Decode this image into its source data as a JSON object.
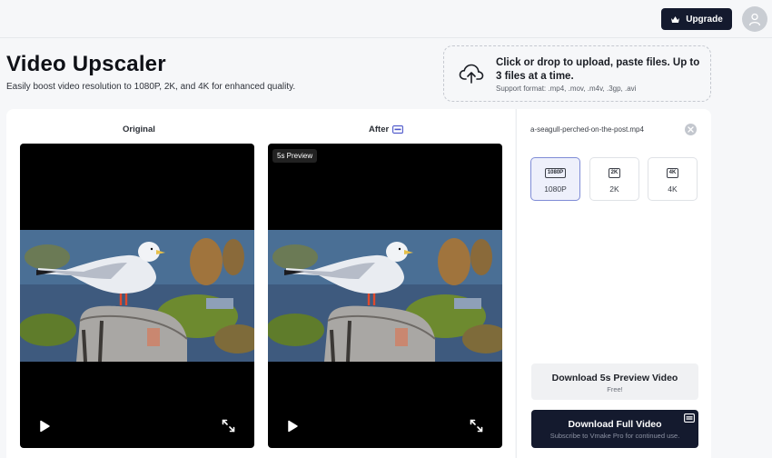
{
  "header": {
    "upgrade_label": "Upgrade"
  },
  "hero": {
    "title": "Video Upscaler",
    "subtitle": "Easily boost video resolution to 1080P, 2K, and 4K for enhanced quality."
  },
  "upload": {
    "main_text": "Click or drop to upload, paste files. Up to 3 files at a time.",
    "formats": "Support format: .mp4, .mov, .m4v, .3gp, .avi"
  },
  "compare": {
    "original_label": "Original",
    "after_label": "After",
    "preview_badge": "5s Preview"
  },
  "file": {
    "name": "a-seagull-perched-on-the-post.mp4"
  },
  "resolutions": [
    {
      "badge": "1080P",
      "label": "1080P",
      "selected": true
    },
    {
      "badge": "2K",
      "label": "2K",
      "selected": false
    },
    {
      "badge": "4K",
      "label": "4K",
      "selected": false
    }
  ],
  "actions": {
    "preview_title": "Download 5s Preview Video",
    "preview_sub": "Free!",
    "full_title": "Download Full Video",
    "full_sub": "Subscribe to Vmake Pro for continued use."
  },
  "colors": {
    "primary_dark": "#141a2e",
    "selected_border": "#7f8cd6",
    "selected_bg": "#eef0fb"
  }
}
